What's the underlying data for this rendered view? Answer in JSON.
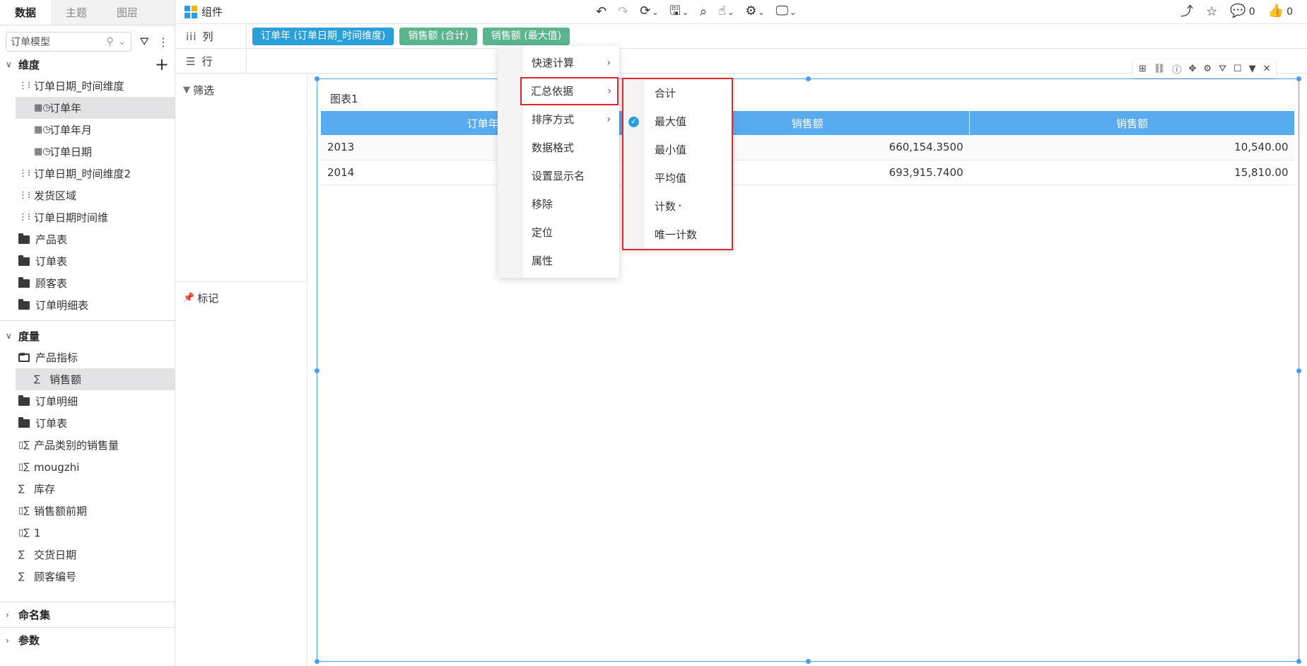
{
  "left": {
    "tabs": [
      {
        "label": "数据",
        "active": true
      },
      {
        "label": "主题",
        "active": false
      },
      {
        "label": "图层",
        "active": false
      }
    ],
    "model_select": "订单模型",
    "dimensions": {
      "title": "维度",
      "items": [
        {
          "label": "订单日期_时间维度",
          "icon": "hierarchy-icon",
          "level": 1
        },
        {
          "label": "订单年",
          "icon": "date-field-icon",
          "level": 2,
          "selected": true
        },
        {
          "label": "订单年月",
          "icon": "date-field-icon",
          "level": 2
        },
        {
          "label": "订单日期",
          "icon": "date-field-icon",
          "level": 2
        },
        {
          "label": "订单日期_时间维度2",
          "icon": "hierarchy-icon",
          "level": 1
        },
        {
          "label": "发货区域",
          "icon": "hierarchy-icon",
          "level": 1
        },
        {
          "label": "订单日期时间维",
          "icon": "hierarchy-icon",
          "level": 1
        },
        {
          "label": "产品表",
          "icon": "folder-icon",
          "level": 1
        },
        {
          "label": "订单表",
          "icon": "folder-icon",
          "level": 1
        },
        {
          "label": "顾客表",
          "icon": "folder-icon",
          "level": 1
        },
        {
          "label": "订单明细表",
          "icon": "folder-icon",
          "level": 1
        }
      ]
    },
    "measures": {
      "title": "度量",
      "items": [
        {
          "label": "产品指标",
          "icon": "folder-open-icon",
          "level": 1
        },
        {
          "label": "销售额",
          "icon": "sigma-icon",
          "level": 2,
          "selected": true
        },
        {
          "label": "订单明细",
          "icon": "folder-icon",
          "level": 1
        },
        {
          "label": "订单表",
          "icon": "folder-icon",
          "level": 1
        },
        {
          "label": "产品类别的销售量",
          "icon": "calc-measure-icon",
          "level": 1
        },
        {
          "label": "mougzhi",
          "icon": "calc-measure-icon",
          "level": 1
        },
        {
          "label": "库存",
          "icon": "sigma-icon",
          "level": 1
        },
        {
          "label": "销售额前期",
          "icon": "calc-measure-icon",
          "level": 1
        },
        {
          "label": "1",
          "icon": "calc-measure-icon",
          "level": 1
        },
        {
          "label": "交货日期",
          "icon": "sigma-icon",
          "level": 1
        },
        {
          "label": "顾客编号",
          "icon": "sigma-icon",
          "level": 1
        }
      ]
    },
    "named_sets": "命名集",
    "params": "参数"
  },
  "toolbar": {
    "component_label": "组件",
    "likes": "0",
    "comments": "0"
  },
  "shelves": {
    "columns_label": "列",
    "rows_label": "行",
    "pills": [
      {
        "label": "订单年 (订单日期_时间维度)",
        "type": "dim"
      },
      {
        "label": "销售额 (合计)",
        "type": "mea"
      },
      {
        "label": "销售额 (最大值)",
        "type": "mea"
      }
    ]
  },
  "panel": {
    "filter_label": "筛选",
    "mark_label": "标记"
  },
  "chart": {
    "title": "图表1",
    "headers": [
      "订单年",
      "销售额",
      "销售额"
    ],
    "rows": [
      [
        "2013",
        "660,154.3500",
        "10,540.00"
      ],
      [
        "2014",
        "693,915.7400",
        "15,810.00"
      ]
    ]
  },
  "context_menu": [
    {
      "label": "快速计算",
      "arrow": true
    },
    {
      "label": "汇总依据",
      "arrow": true,
      "highlight": true
    },
    {
      "label": "排序方式",
      "arrow": true
    },
    {
      "label": "数据格式"
    },
    {
      "label": "设置显示名"
    },
    {
      "label": "移除"
    },
    {
      "label": "定位"
    },
    {
      "label": "属性"
    }
  ],
  "sub_menu": [
    {
      "label": "合计"
    },
    {
      "label": "最大值",
      "checked": true
    },
    {
      "label": "最小值"
    },
    {
      "label": "平均值"
    },
    {
      "label": "计数",
      "red_dot": true
    },
    {
      "label": "唯一计数"
    }
  ],
  "colors": {
    "accent": "#2a9fd8",
    "measure_pill": "#5ab58e",
    "table_header": "#58abef",
    "highlight": "#e3262b"
  }
}
